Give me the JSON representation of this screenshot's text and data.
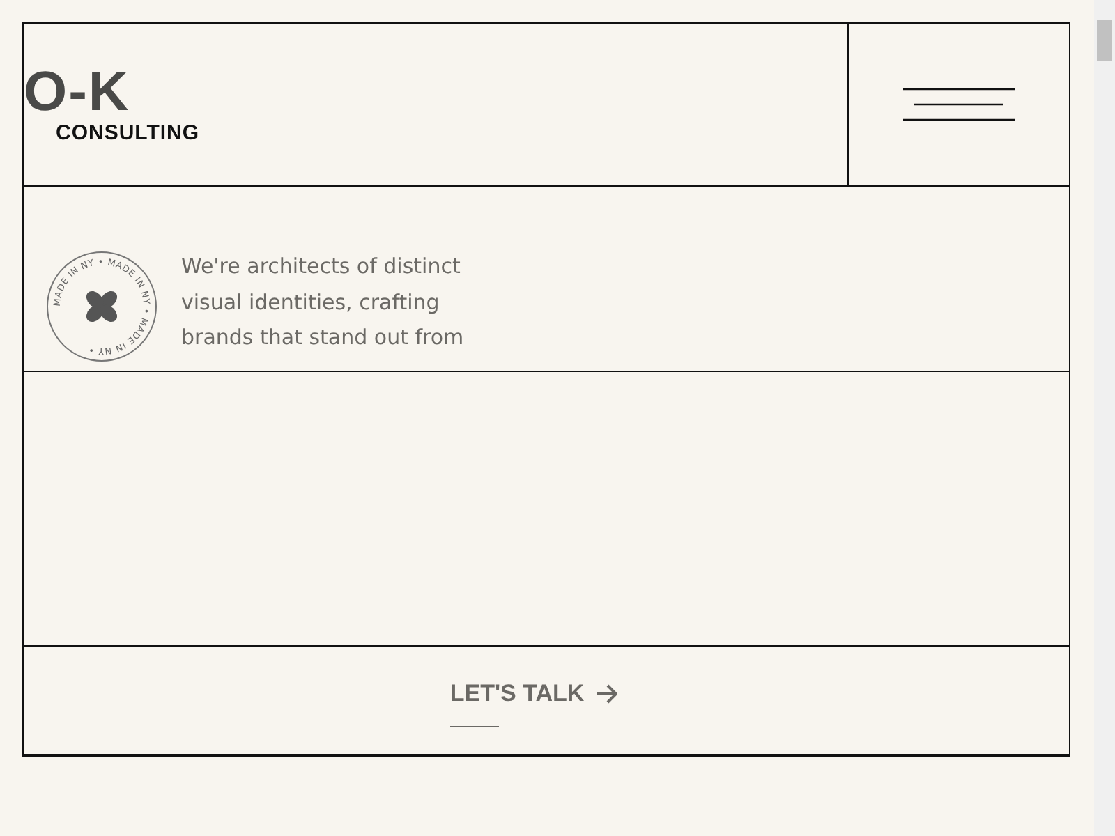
{
  "header": {
    "logo_mark": "O-K",
    "logo_subtitle": "CONSULTING"
  },
  "hero": {
    "stamp_text": "MADE IN NY • MADE IN NY • MADE IN NY •",
    "intro": "We're architects of distinct visual identities, crafting brands that stand out from"
  },
  "cta": {
    "label": "LET'S TALK"
  }
}
